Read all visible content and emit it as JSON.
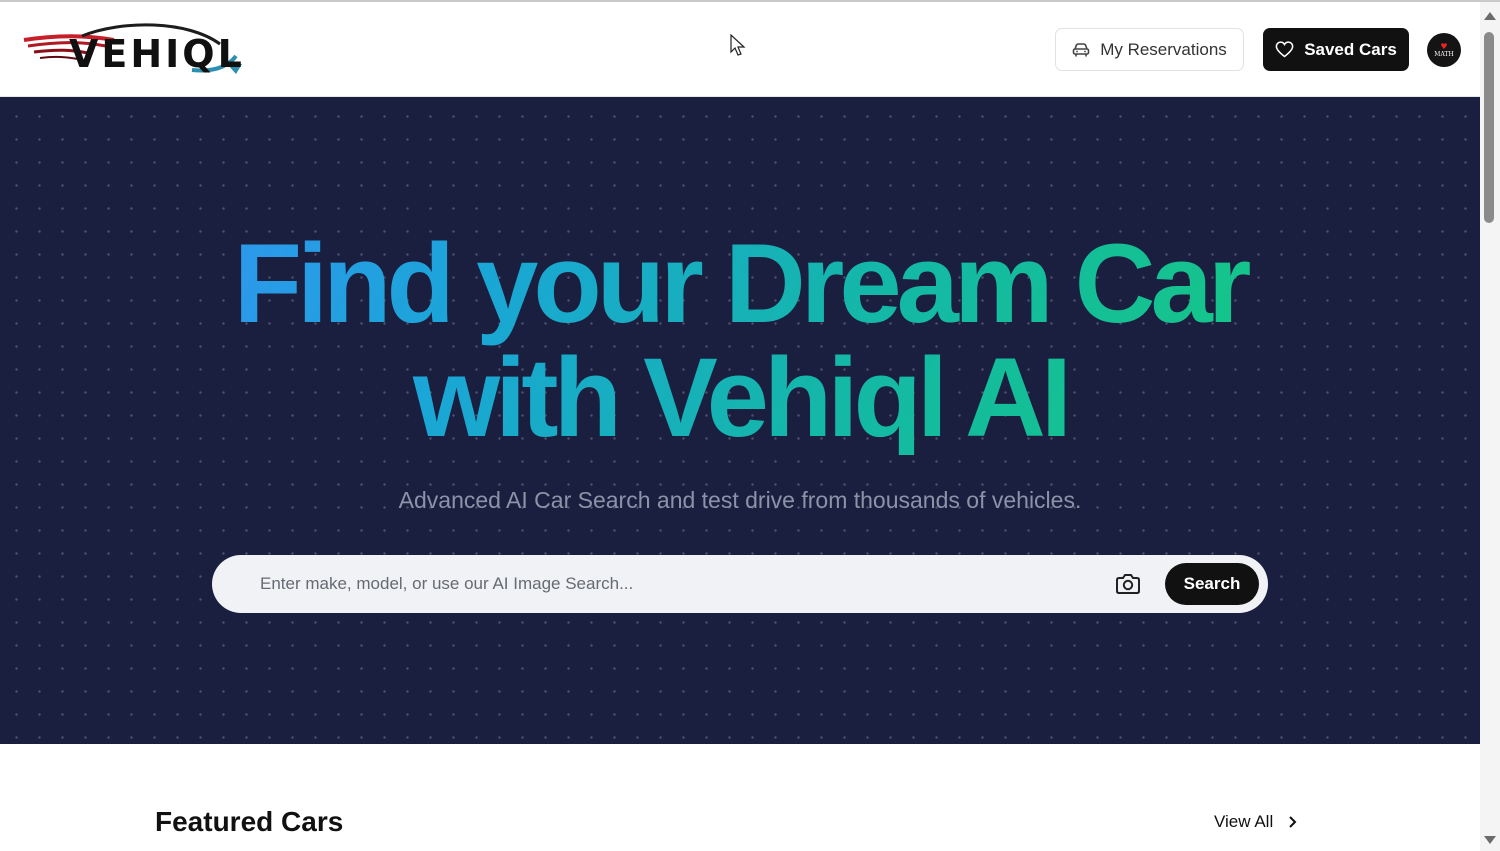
{
  "header": {
    "logo_text": "VEHIQL",
    "reservations_label": "My Reservations",
    "saved_label": "Saved Cars",
    "avatar_text": "MATH"
  },
  "hero": {
    "title_line1": "Find your Dream Car",
    "title_line2": "with Vehiql AI",
    "subtitle": "Advanced AI Car Search and test drive from thousands of vehicles.",
    "search_placeholder": "Enter make, model, or use our AI Image Search...",
    "search_button": "Search"
  },
  "featured": {
    "title": "Featured Cars",
    "view_all": "View All"
  },
  "icons": {
    "reservations": "car-icon",
    "saved": "heart-icon",
    "camera": "camera-icon",
    "view_all": "chevron-right-icon"
  },
  "colors": {
    "hero_bg": "#1a1f40",
    "gradient_start": "#3d8cff",
    "gradient_end": "#16cf72",
    "button_dark": "#111111"
  }
}
